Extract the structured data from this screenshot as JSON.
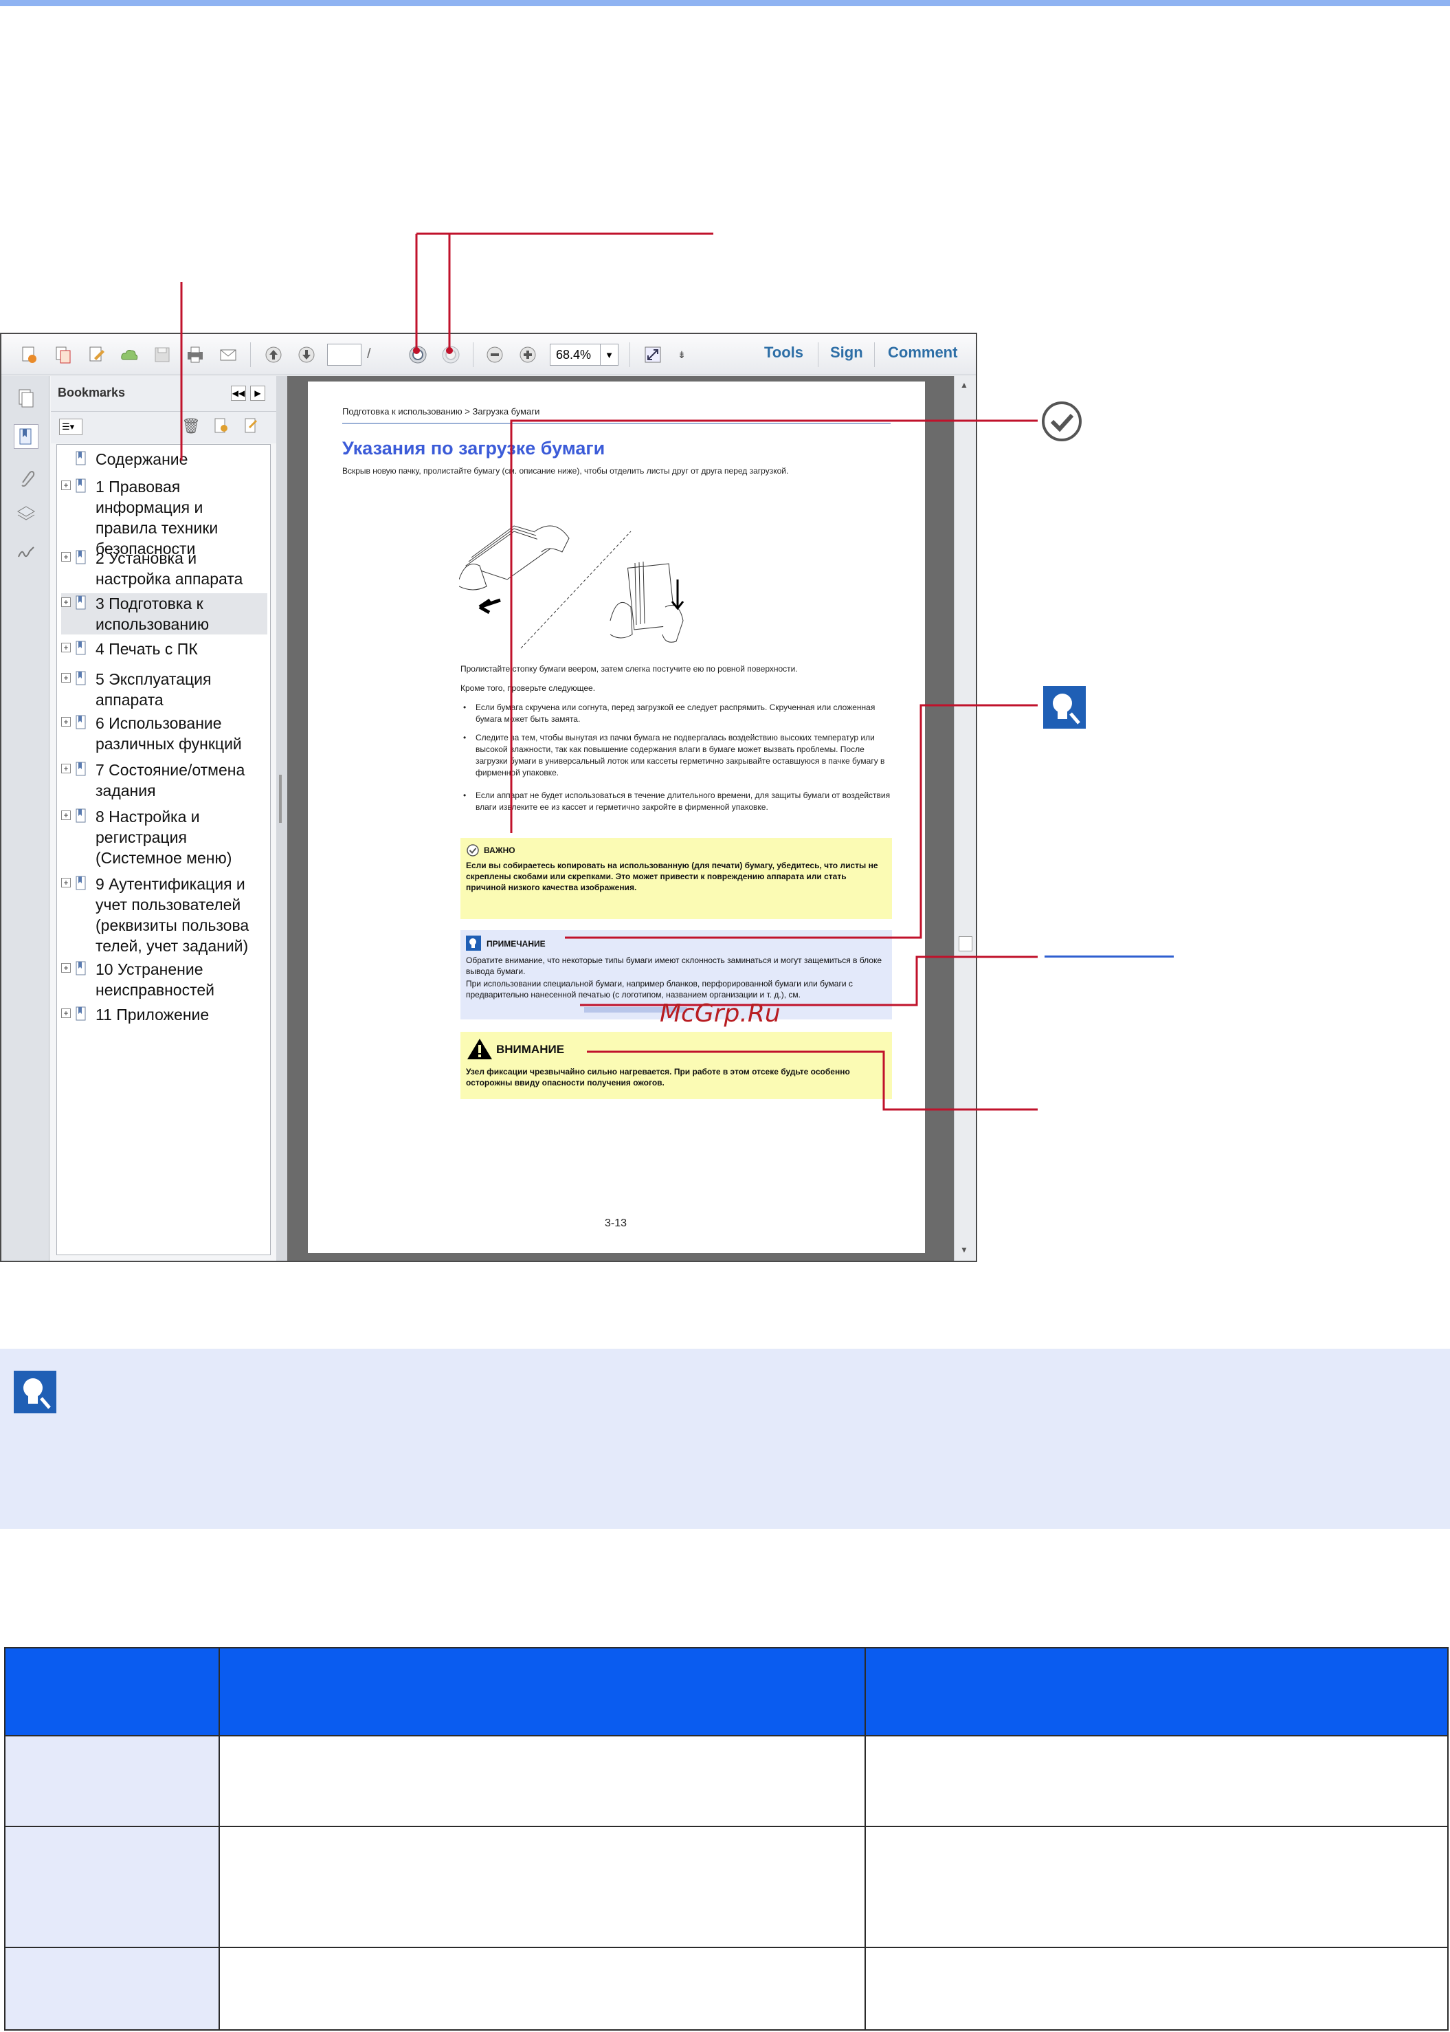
{
  "viewer": {
    "toolbar": {
      "page_current": "",
      "page_total": "/",
      "zoom": "68.4%",
      "tools_label": "Tools",
      "sign_label": "Sign",
      "comment_label": "Comment"
    },
    "bookmarks": {
      "title": "Bookmarks",
      "items": [
        {
          "label": "Содержание",
          "expand": ""
        },
        {
          "label": "1 Правовая информация и правила техники безопасности",
          "expand": "+"
        },
        {
          "label": "2 Установка и настройка аппарата",
          "expand": "+"
        },
        {
          "label": "3 Подготовка к использованию",
          "expand": "+"
        },
        {
          "label": "4 Печать с ПК",
          "expand": "+"
        },
        {
          "label": "5 Эксплуатация аппарата",
          "expand": "+"
        },
        {
          "label": "6 Использование различных функций",
          "expand": "+"
        },
        {
          "label": "7 Состояние/отмена задания",
          "expand": "+"
        },
        {
          "label": "8 Настройка и регистрация (Системное меню)",
          "expand": "+"
        },
        {
          "label": "9 Аутентификация и учет пользователей (реквизиты пользова телей, учет заданий)",
          "expand": "+"
        },
        {
          "label": "10 Устранение неисправностей",
          "expand": "+"
        },
        {
          "label": "11 Приложение",
          "expand": "+"
        }
      ]
    },
    "document": {
      "breadcrumb": "Подготовка к использованию > Загрузка бумаги",
      "title": "Указания по загрузке бумаги",
      "intro": "Вскрыв новую пачку, пролистайте бумагу (см. описание ниже), чтобы отделить листы друг от друга перед загрузкой.",
      "fan_text": "Пролистайте стопку бумаги веером, затем слегка постучите ею по ровной поверхности.",
      "check_text": "Кроме того, проверьте следующее.",
      "bullets": [
        "Если бумага скручена или согнута, перед загрузкой ее следует распрямить. Скрученная или сложенная бумага может быть замята.",
        "Следите за тем, чтобы вынутая из пачки бумага не подвергалась воздействию высоких температур или высокой влажности, так как повышение содержания влаги в бумаге может вызвать проблемы. После загрузки бумаги в универсальный лоток или кассеты герметично закрывайте оставшуюся в пачке бумагу в фирменной упаковке.",
        "Если аппарат не будет использоваться в течение длительного времени, для защиты бумаги от воздействия влаги извлеките ее из кассет и герметично закройте в фирменной упаковке."
      ],
      "important_label": "ВАЖНО",
      "important_text": "Если вы собираетесь копировать на использованную (для печати) бумагу, убедитесь, что листы не скреплены скобами или скрепками. Это может привести к повреждению аппарата или стать причиной низкого качества изображения.",
      "note_label": "ПРИМЕЧАНИЕ",
      "note_text_1": "Обратите внимание, что некоторые типы бумаги имеют склонность заминаться и могут защемиться в блоке вывода бумаги.",
      "note_text_2": "При использовании специальной бумаги, например бланков, перфорированной бумаги или бумаги с предварительно нанесенной печатью (с логотипом, названием организации и т. д.), см.",
      "caution_label": "ВНИМАНИЕ",
      "caution_text": "Узел фиксации чрезвычайно сильно нагревается. При работе в этом отсеке будьте особенно осторожны ввиду опасности получения ожогов.",
      "page_number": "3-13"
    }
  },
  "watermark": "McGrp.Ru",
  "colors": {
    "accent_bar": "#8fb3f2",
    "callout_line": "#c0122b",
    "table_header": "#0a5cf0",
    "note_bg": "#e4eafa"
  },
  "icons": [
    "checkmark-circle-icon",
    "note-bulb-icon",
    "warning-triangle-icon"
  ]
}
